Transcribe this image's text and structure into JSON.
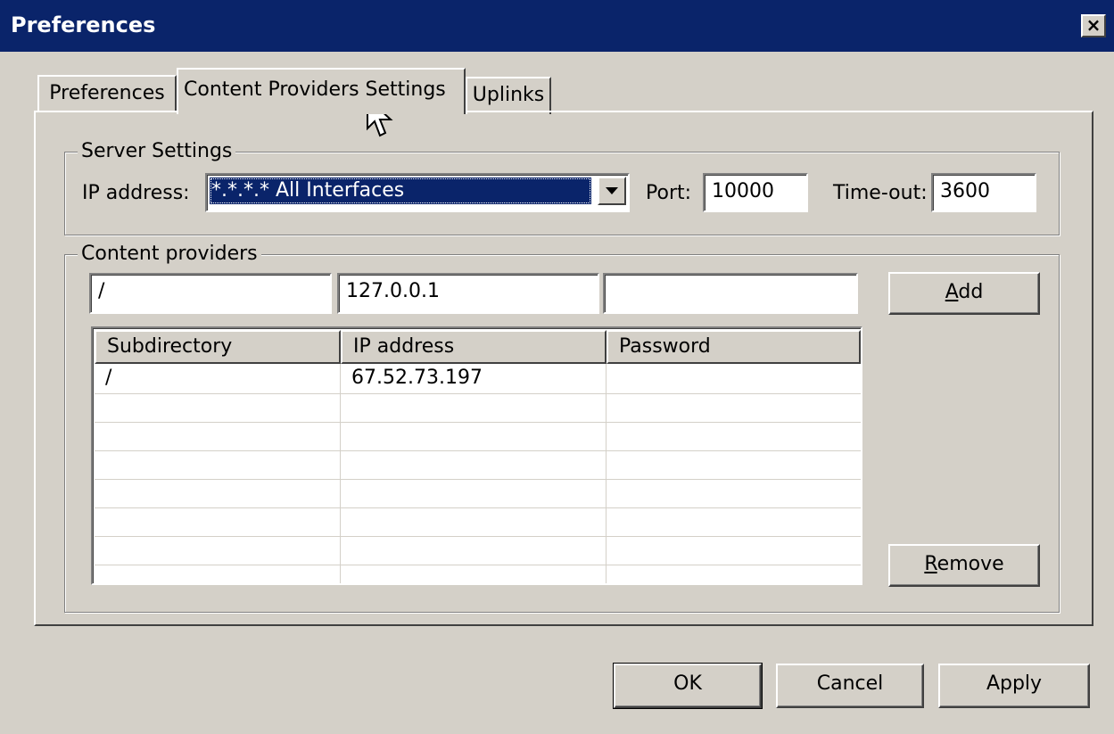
{
  "window": {
    "title": "Preferences",
    "close_label": "×"
  },
  "tabs": [
    {
      "label": "Preferences",
      "active": false
    },
    {
      "label": "Content Providers Settings",
      "active": true
    },
    {
      "label": "Uplinks",
      "active": false
    }
  ],
  "server_settings": {
    "legend": "Server Settings",
    "ip_label": "IP address:",
    "ip_value": "*.*.*.* All Interfaces",
    "port_label": "Port:",
    "port_value": "10000",
    "timeout_label": "Time-out:",
    "timeout_value": "3600"
  },
  "content_providers": {
    "legend": "Content providers",
    "inputs": {
      "subdirectory": "/",
      "ip_address": "127.0.0.1",
      "password": ""
    },
    "add_button": {
      "accel": "A",
      "rest": "dd"
    },
    "remove_button": {
      "accel": "R",
      "rest": "emove"
    },
    "columns": [
      "Subdirectory",
      "IP address",
      "Password"
    ],
    "rows": [
      {
        "subdirectory": "/",
        "ip_address": "67.52.73.197",
        "password": ""
      }
    ]
  },
  "buttons": {
    "ok": "OK",
    "cancel": "Cancel",
    "apply": "Apply"
  },
  "colors": {
    "titlebar": "#0a246a",
    "face": "#d4d0c8",
    "selection": "#0a246a"
  },
  "icons": {
    "close": "close-icon",
    "dropdown": "chevron-down-icon",
    "cursor": "mouse-pointer-icon"
  }
}
